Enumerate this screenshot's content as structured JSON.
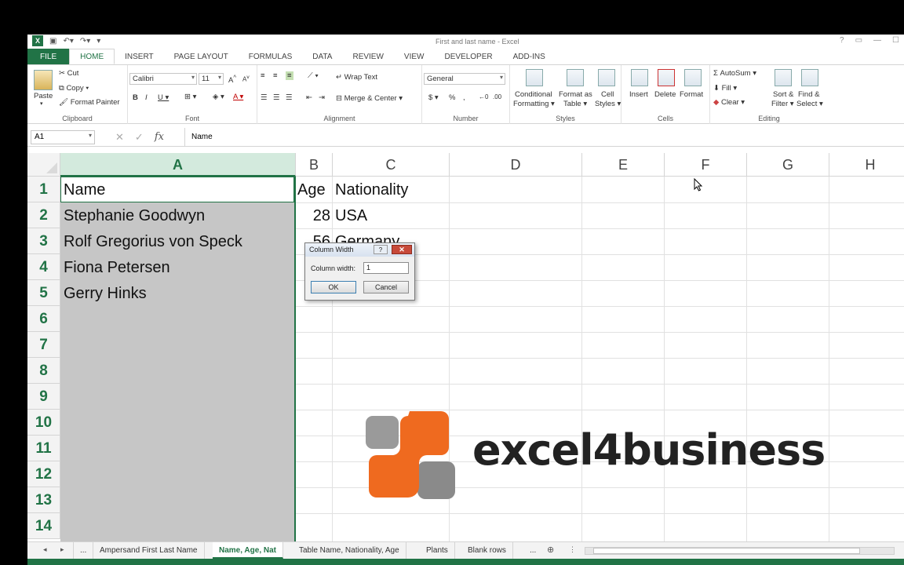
{
  "window": {
    "title": "First and last name - Excel"
  },
  "ribbon_tabs": [
    "FILE",
    "HOME",
    "INSERT",
    "PAGE LAYOUT",
    "FORMULAS",
    "DATA",
    "REVIEW",
    "VIEW",
    "DEVELOPER",
    "ADD-INS"
  ],
  "ribbon": {
    "clipboard": {
      "paste": "Paste",
      "cut": "Cut",
      "copy": "Copy",
      "format_painter": "Format Painter",
      "label": "Clipboard"
    },
    "font": {
      "name": "Calibri",
      "size": "11",
      "label": "Font"
    },
    "alignment": {
      "wrap_text": "Wrap Text",
      "merge_center": "Merge & Center",
      "label": "Alignment"
    },
    "number": {
      "format": "General",
      "label": "Number"
    },
    "styles": {
      "conditional": "Conditional",
      "formatting": "Formatting",
      "format_as": "Format as",
      "table": "Table",
      "cell": "Cell",
      "styles": "Styles",
      "label": "Styles"
    },
    "cells": {
      "insert": "Insert",
      "delete": "Delete",
      "format": "Format",
      "label": "Cells"
    },
    "editing": {
      "autosum": "AutoSum",
      "fill": "Fill",
      "clear": "Clear",
      "sort": "Sort &",
      "filter": "Filter",
      "find": "Find &",
      "select": "Select",
      "label": "Editing"
    }
  },
  "formula_bar": {
    "name_box": "A1",
    "content": "Name"
  },
  "columns": [
    "A",
    "B",
    "C",
    "D",
    "E",
    "F",
    "G",
    "H"
  ],
  "rows": [
    "1",
    "2",
    "3",
    "4",
    "5",
    "6",
    "7",
    "8",
    "9",
    "10",
    "11",
    "12",
    "13",
    "14"
  ],
  "cells": {
    "A1": "Name",
    "B1": "Age",
    "C1": "Nationality",
    "A2": "Stephanie Goodwyn",
    "B2": "28",
    "C2": "USA",
    "A3": "Rolf Gregorius von Speck",
    "B3": "56",
    "C3": "Germany",
    "A4": "Fiona Petersen",
    "A5": "Gerry Hinks"
  },
  "dialog": {
    "title": "Column Width",
    "help": "?",
    "close": "✕",
    "label": "Column width:",
    "value": "1",
    "ok": "OK",
    "cancel": "Cancel"
  },
  "logo": {
    "text": "excel4business"
  },
  "sheet_tabs": [
    "...",
    "Ampersand First Last Name",
    "Name, Age, Nat",
    "Table Name, Nationality, Age",
    "Plants",
    "Blank rows",
    "..."
  ],
  "active_sheet": "Name, Age, Nat",
  "colors": {
    "excel_green": "#217346",
    "selection_gray": "#c6c6c6",
    "logo_orange": "#ef6a1f",
    "logo_gray": "#8a8a8a"
  }
}
